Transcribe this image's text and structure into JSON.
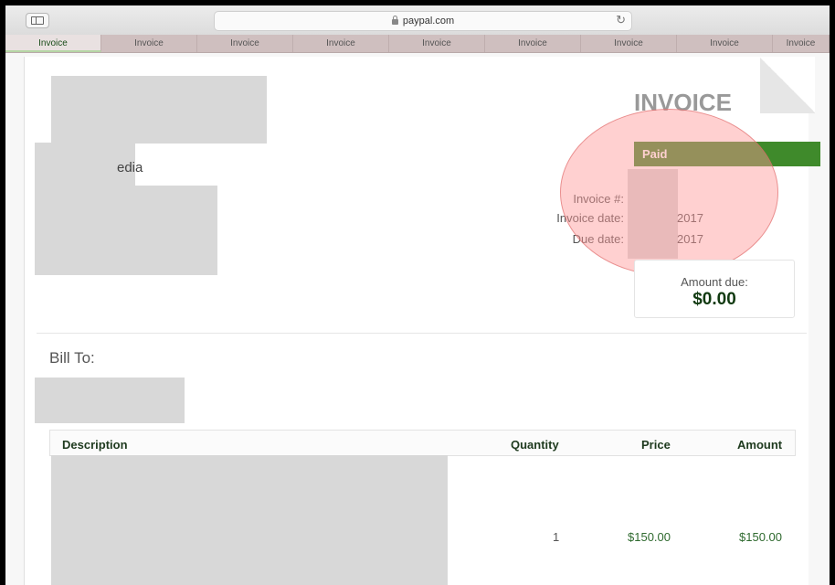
{
  "browser": {
    "address": "paypal.com",
    "tabs": [
      "Invoice",
      "Invoice",
      "Invoice",
      "Invoice",
      "Invoice",
      "Invoice",
      "Invoice",
      "Invoice",
      "Invoice"
    ]
  },
  "invoice": {
    "title": "INVOICE",
    "company_name_fragment": "edia",
    "status": "Paid",
    "labels": {
      "invoice_number": "Invoice #:",
      "invoice_date": "Invoice date:",
      "due_date": "Due date:"
    },
    "values": {
      "invoice_date_fragment": "2017",
      "due_date_fragment": "2017"
    },
    "amount_due_label": "Amount due:",
    "amount_due_value": "$0.00",
    "bill_to": "Bill To:",
    "table": {
      "headers": {
        "description": "Description",
        "quantity": "Quantity",
        "price": "Price",
        "amount": "Amount"
      },
      "rows": [
        {
          "quantity": "1",
          "price": "$150.00",
          "amount": "$150.00"
        }
      ]
    }
  },
  "colors": {
    "paid_green": "#3f8a2b",
    "tab_bar": "#cfbfbf",
    "highlight_circle": "#ff9696"
  }
}
